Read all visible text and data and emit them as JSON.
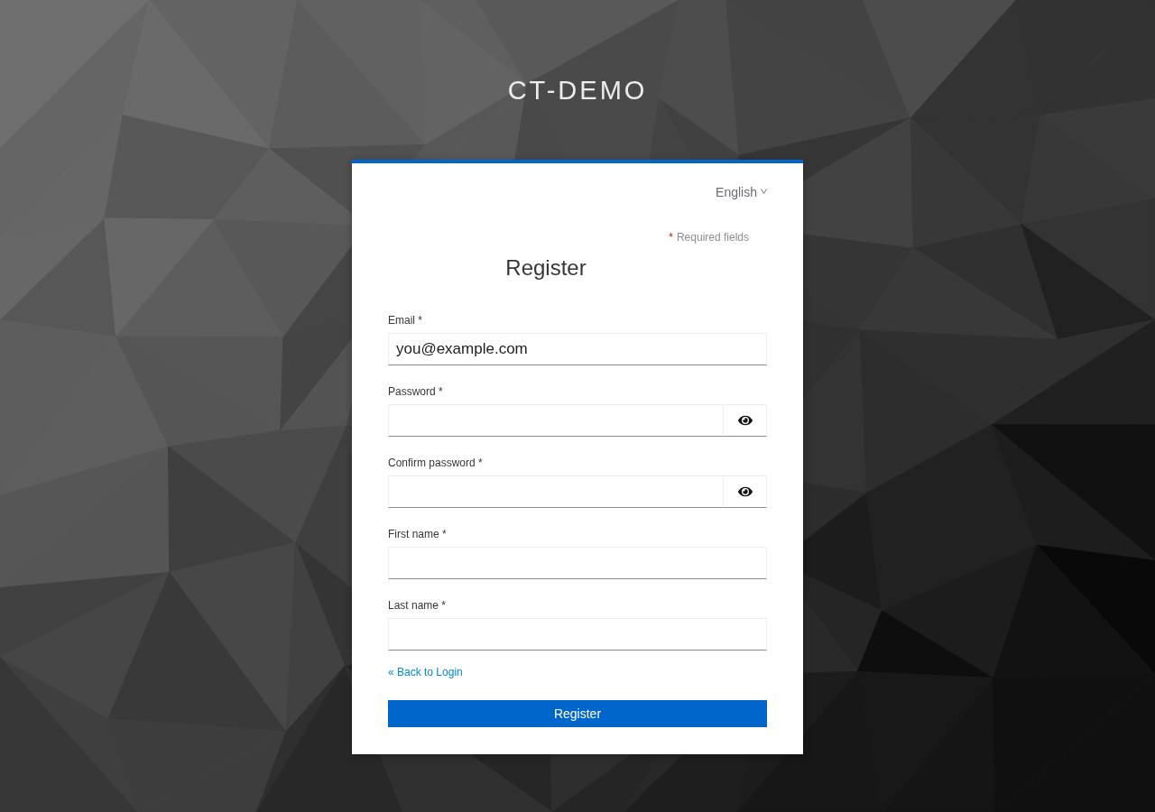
{
  "app_title": "CT-DEMO",
  "language_menu": {
    "label": "English"
  },
  "required_note": {
    "marker": "*",
    "text": "Required fields"
  },
  "heading": "Register",
  "fields": [
    {
      "label": "Email *",
      "kind": "text",
      "value": "you@example.com"
    },
    {
      "label": "Password *",
      "kind": "password"
    },
    {
      "label": "Confirm password *",
      "kind": "password"
    },
    {
      "label": "First name *",
      "kind": "text"
    },
    {
      "label": "Last name *",
      "kind": "text"
    }
  ],
  "back_link": "« Back to Login",
  "submit_button": "Register"
}
